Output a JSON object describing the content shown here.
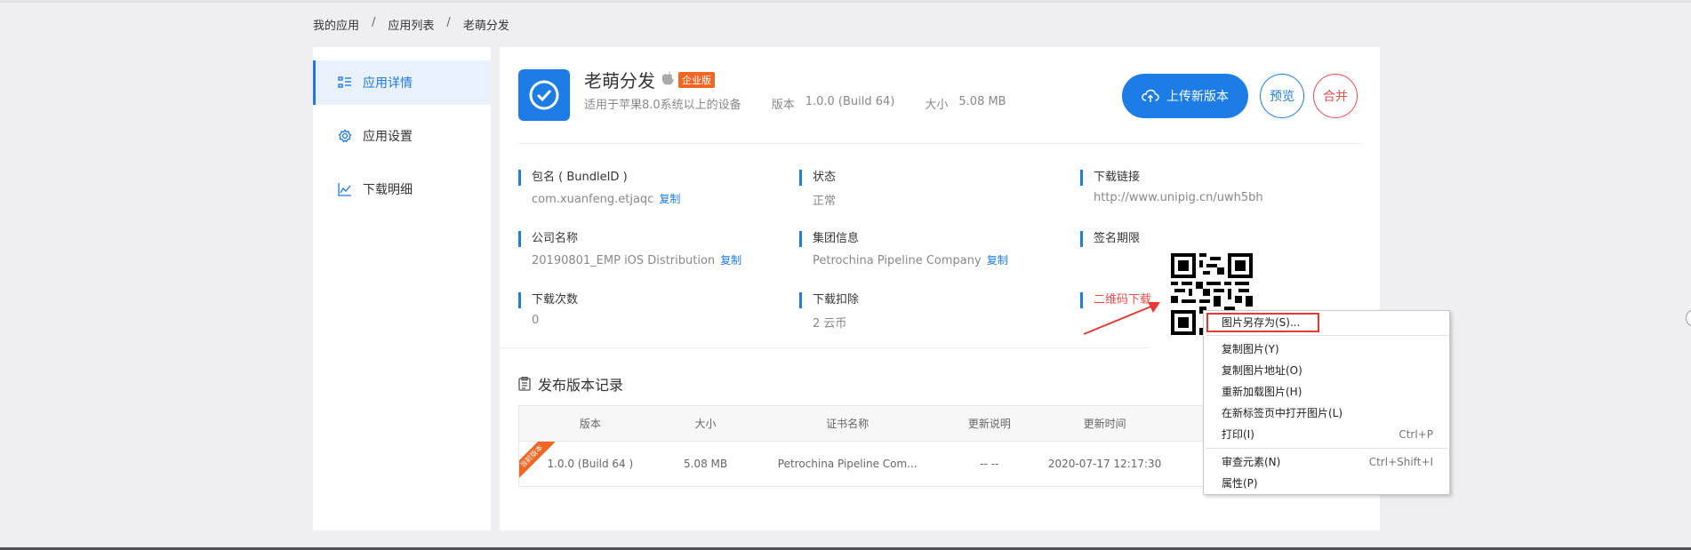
{
  "breadcrumb": [
    "我的应用",
    "应用列表",
    "老萌分发"
  ],
  "breadcrumb_sep": "/",
  "sidebar": {
    "items": [
      {
        "label": "应用详情",
        "icon": "list-icon",
        "active": true
      },
      {
        "label": "应用设置",
        "icon": "gear-icon",
        "active": false
      },
      {
        "label": "下载明细",
        "icon": "chart-icon",
        "active": false
      }
    ]
  },
  "app": {
    "name": "老萌分发",
    "badge": "企业版",
    "subtitle": "适用于苹果8.0系统以上的设备",
    "version_label": "版本",
    "version_value": "1.0.0 (Build 64)",
    "size_label": "大小",
    "size_value": "5.08 MB"
  },
  "buttons": {
    "upload": "上传新版本",
    "preview": "预览",
    "merge": "合并"
  },
  "info": {
    "bundle_label": "包名 ( BundleID )",
    "bundle_value": "com.xuanfeng.etjaqc",
    "status_label": "状态",
    "status_value": "正常",
    "link_label": "下载链接",
    "link_value": "http://www.unipig.cn/uwh5bh",
    "company_label": "公司名称",
    "company_value": "20190801_EMP iOS Distribution",
    "group_label": "集团信息",
    "group_value": "Petrochina Pipeline Company",
    "sign_label": "签名期限",
    "downloads_label": "下载次数",
    "downloads_value": "0",
    "deduct_label": "下载扣除",
    "deduct_value": "2 云币",
    "qr_label": "二维码下载",
    "copy": "复制"
  },
  "records": {
    "title": "发布版本记录",
    "columns": [
      "版本",
      "大小",
      "证书名称",
      "更新说明",
      "更新时间"
    ],
    "rows": [
      {
        "ribbon": "当前版本",
        "version": "1.0.0 (Build 64 )",
        "size": "5.08 MB",
        "cert": "Petrochina Pipeline Com...",
        "note": "-- --",
        "time": "2020-07-17 12:17:30"
      }
    ]
  },
  "context_menu": {
    "items": [
      {
        "label": "图片另存为(S)...",
        "shortcut": ""
      },
      {
        "label": "复制图片(Y)",
        "shortcut": ""
      },
      {
        "label": "复制图片地址(O)",
        "shortcut": ""
      },
      {
        "label": "重新加载图片(H)",
        "shortcut": ""
      },
      {
        "label": "在新标签页中打开图片(L)",
        "shortcut": ""
      },
      {
        "label": "打印(I)",
        "shortcut": "Ctrl+P"
      },
      {
        "label": "审查元素(N)",
        "shortcut": "Ctrl+Shift+I"
      },
      {
        "label": "属性(P)",
        "shortcut": ""
      }
    ]
  },
  "colors": {
    "accent": "#1e7ce6",
    "danger": "#e84c4c",
    "badge": "#f26522"
  }
}
